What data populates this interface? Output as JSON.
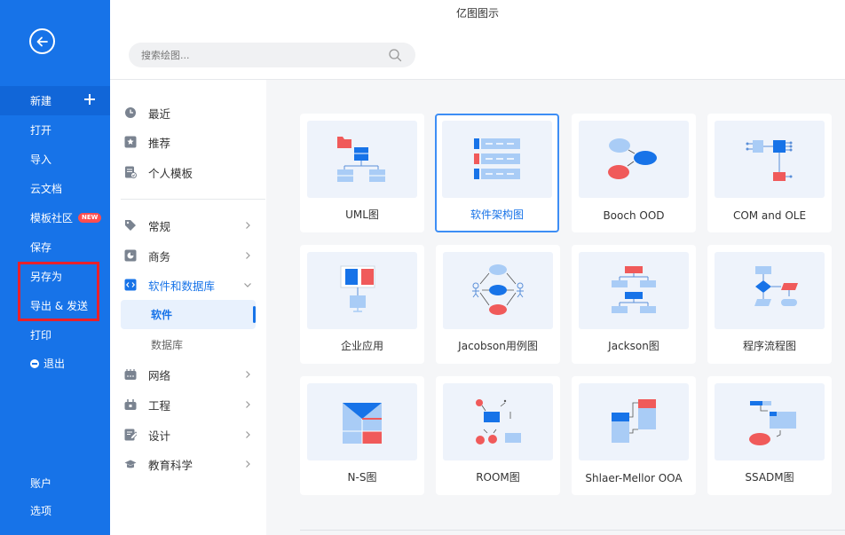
{
  "app": {
    "title": "亿图图示"
  },
  "search": {
    "placeholder": "搜索绘图..."
  },
  "sidebar": {
    "items": [
      {
        "label": "新建"
      },
      {
        "label": "打开"
      },
      {
        "label": "导入"
      },
      {
        "label": "云文档"
      },
      {
        "label": "模板社区",
        "badge": "NEW"
      },
      {
        "label": "保存"
      },
      {
        "label": "另存为"
      },
      {
        "label": "导出 & 发送"
      },
      {
        "label": "打印"
      },
      {
        "label": "退出"
      },
      {
        "label": "账户"
      },
      {
        "label": "选项"
      }
    ]
  },
  "nav": {
    "top": [
      {
        "label": "最近"
      },
      {
        "label": "推荐"
      },
      {
        "label": "个人模板"
      }
    ],
    "categories": [
      {
        "label": "常规"
      },
      {
        "label": "商务"
      },
      {
        "label": "软件和数据库"
      },
      {
        "label": "网络"
      },
      {
        "label": "工程"
      },
      {
        "label": "设计"
      },
      {
        "label": "教育科学"
      }
    ],
    "subs": [
      {
        "label": "软件"
      },
      {
        "label": "数据库"
      }
    ]
  },
  "templates": [
    {
      "label": "UML图"
    },
    {
      "label": "软件架构图"
    },
    {
      "label": "Booch OOD"
    },
    {
      "label": "COM and OLE"
    },
    {
      "label": "企业应用"
    },
    {
      "label": "Jacobson用例图"
    },
    {
      "label": "Jackson图"
    },
    {
      "label": "程序流程图"
    },
    {
      "label": "N-S图"
    },
    {
      "label": "ROOM图"
    },
    {
      "label": "Shlaer-Mellor OOA"
    },
    {
      "label": "SSADM图"
    }
  ],
  "colors": {
    "primary": "#1773e8",
    "accent_red": "#f05a5a",
    "light_blue": "#a9ccf6",
    "highlight": "#e8202a"
  }
}
